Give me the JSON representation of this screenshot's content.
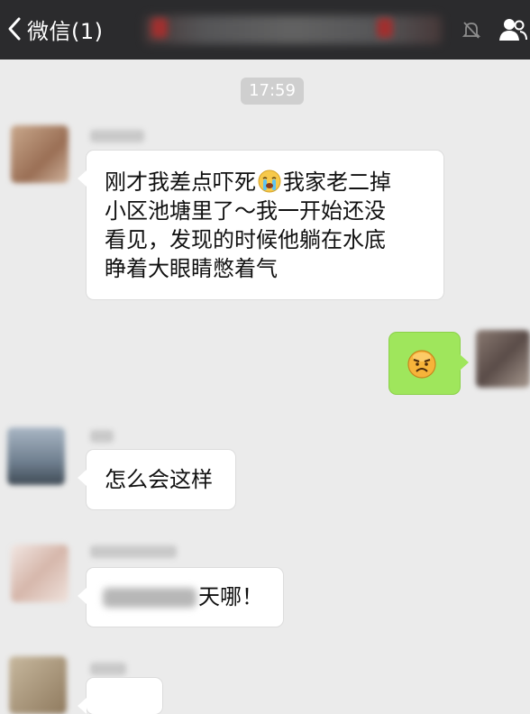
{
  "topbar": {
    "back_label": "微信(1)"
  },
  "chat": {
    "time_label": "17:59",
    "messages": {
      "m1": {
        "before_emoji": "刚才我差点吓死",
        "after_emoji": "我家老二掉",
        "line2": "小区池塘里了～我一开始还没",
        "line3": "看见，发现的时候他躺在水底",
        "line4": "睁着大眼睛憋着气"
      },
      "m3": {
        "text": "怎么会这样"
      },
      "m4": {
        "text": "天哪！"
      }
    }
  },
  "colors": {
    "topbar": "#2b2b2d",
    "background": "#ebebeb",
    "my_bubble": "#9fe65c",
    "other_bubble": "#ffffff",
    "time_pill": "#cfcfcf"
  },
  "icons": [
    "back-arrow-icon",
    "mute-icon",
    "contact-info-icon",
    "cry-emoji-icon",
    "angry-emoji-icon"
  ]
}
